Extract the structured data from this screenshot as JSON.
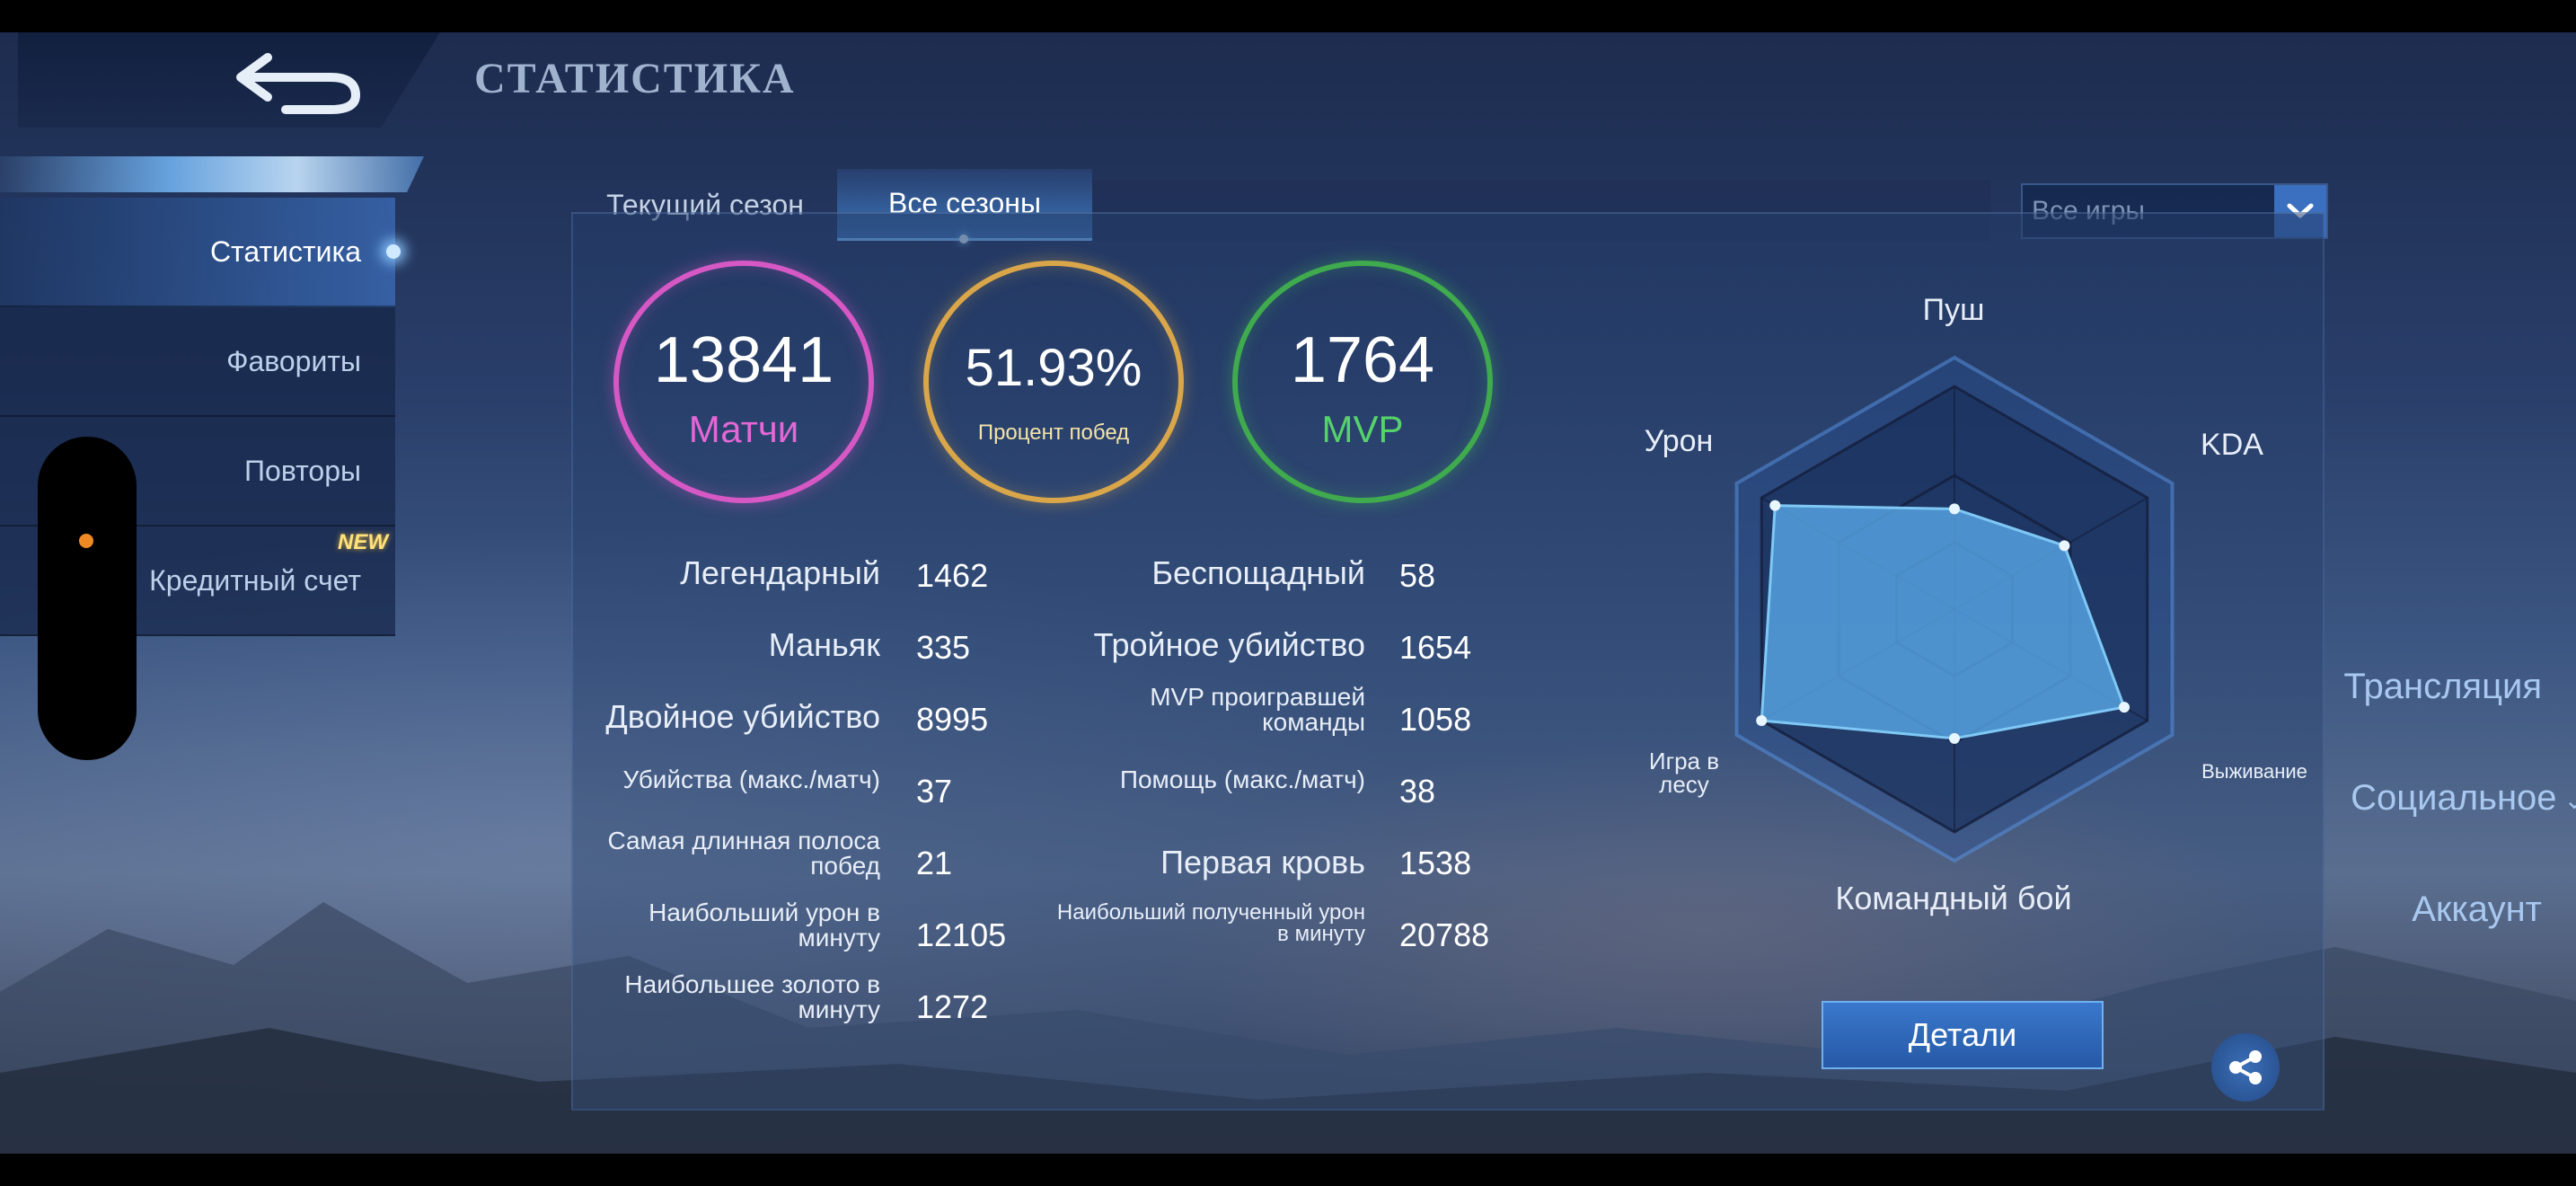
{
  "header": {
    "title": "СТАТИСТИКА",
    "back_icon": "back-arrow-icon"
  },
  "sidebar": {
    "items": [
      {
        "label": "Статистика",
        "active": true
      },
      {
        "label": "Фавориты"
      },
      {
        "label": "Повторы"
      },
      {
        "label": "Кредитный счет",
        "badge": "NEW"
      }
    ],
    "links": [
      "Трансляция",
      "Социальное",
      "Аккаунт"
    ]
  },
  "tabs": {
    "current": "Текущий сезон",
    "all": "Все сезоны",
    "selected": "all"
  },
  "filter": {
    "value": "Все игры"
  },
  "summary": {
    "matches": {
      "value": "13841",
      "label": "Матчи",
      "color": "#d558c5"
    },
    "winrate": {
      "value": "51.93%",
      "label": "Процент побед",
      "color": "#d9a64a"
    },
    "mvp": {
      "value": "1764",
      "label": "MVP",
      "color": "#3faa4e"
    }
  },
  "stats_left": [
    {
      "label": "Легендарный",
      "value": "1462"
    },
    {
      "label": "Маньяк",
      "value": "335"
    },
    {
      "label": "Двойное убийство",
      "value": "8995"
    },
    {
      "label": "Убийства (макс./матч)",
      "value": "37"
    },
    {
      "label": "Самая длинная полоса побед",
      "value": "21"
    },
    {
      "label": "Наибольший урон в минуту",
      "value": "12105"
    },
    {
      "label": "Наибольшее золото в минуту",
      "value": "1272"
    }
  ],
  "stats_right": [
    {
      "label": "Беспощадный",
      "value": "58"
    },
    {
      "label": "Тройное убийство",
      "value": "1654"
    },
    {
      "label": "MVP проигравшей команды",
      "value": "1058"
    },
    {
      "label": "Помощь (макс./матч)",
      "value": "38"
    },
    {
      "label": "Первая кровь",
      "value": "1538"
    },
    {
      "label": "Наибольший полученный урон в минуту",
      "value": "20788"
    }
  ],
  "radar": {
    "axes": [
      "Пуш",
      "KDA",
      "Выживание",
      "Командный бой",
      "Игра в лесу",
      "Урон"
    ],
    "values": [
      0.45,
      0.57,
      0.88,
      0.58,
      1.0,
      0.93
    ]
  },
  "actions": {
    "details": "Детали",
    "share_icon": "share-icon"
  }
}
